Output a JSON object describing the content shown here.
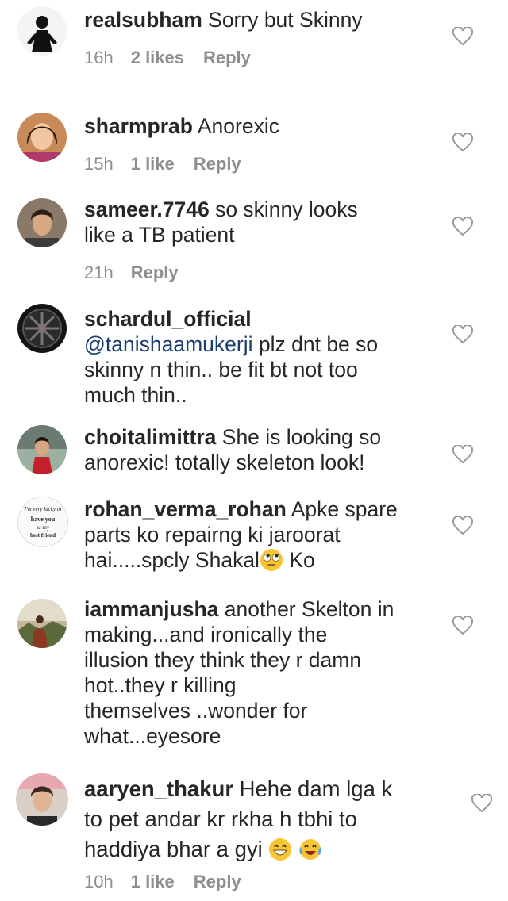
{
  "comments": [
    {
      "username": "realsubham",
      "text": "Sorry but Skinny",
      "time": "16h",
      "likes": "2 likes",
      "reply": "Reply",
      "avatar_icon": "person-silhouette"
    },
    {
      "username": "sharmprab",
      "text": "Anorexic",
      "time": "15h",
      "likes": "1 like",
      "reply": "Reply",
      "avatar_icon": "woman-portrait"
    },
    {
      "username": "sameer.7746",
      "text": "so skinny looks like a TB patient",
      "line2": "like a TB patient",
      "line1": "so skinny looks",
      "time": "21h",
      "reply": "Reply",
      "avatar_icon": "man-portrait"
    },
    {
      "username": "schardul_official",
      "mention": "@tanishaamukerji",
      "text": "plz dnt be so skinny n thin.. be fit bt not too much thin..",
      "line1": "plz dnt be so",
      "line2": "skinny n thin.. be fit bt not too",
      "line3": "much thin..",
      "avatar_icon": "car-wheel"
    },
    {
      "username": "choitalimittra",
      "line1": "She is looking so",
      "line2": "anorexic! totally skeleton look!",
      "avatar_icon": "woman-portrait"
    },
    {
      "username": "rohan_verma_rohan",
      "line1": "Apke spare",
      "line2": "parts ko repairng ki jaroorat",
      "line3": "hai.....spcly Shakal",
      "line3b": "Ko",
      "avatar_text_1": "I'm very lucky to",
      "avatar_text_2": "have you",
      "avatar_text_3": "as my",
      "avatar_text_4": "best friend",
      "avatar_icon": "text-badge"
    },
    {
      "username": "iammanjusha",
      "line1": "another Skelton in",
      "line2": "making...and ironically the",
      "line3": "illusion they think they r damn",
      "line4": "hot..they r killing",
      "line5": "themselves ..wonder for",
      "line6": "what...eyesore",
      "avatar_icon": "landscape"
    },
    {
      "username": "aaryen_thakur",
      "line1": "Hehe dam lga k",
      "line2": "to pet andar kr rkha h tbhi to",
      "line3": "haddiya bhar a gyi",
      "time": "10h",
      "likes": "1 like",
      "reply": "Reply",
      "avatar_icon": "man-portrait"
    }
  ],
  "colors": {
    "text": "#262626",
    "meta": "#8e8e8e",
    "mention": "#1a3d6e",
    "heart": "#9a9a9a"
  }
}
